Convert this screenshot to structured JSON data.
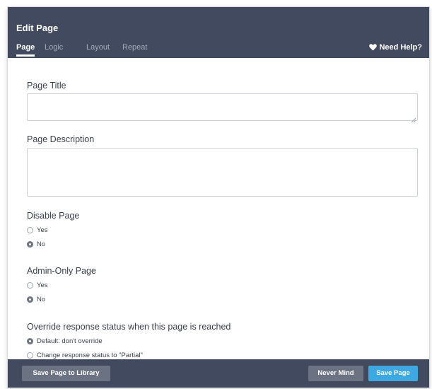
{
  "header": {
    "title": "Edit Page",
    "tabs": [
      {
        "label": "Page",
        "active": true
      },
      {
        "label": "Logic",
        "active": false
      },
      {
        "label": "Layout",
        "active": false
      },
      {
        "label": "Repeat",
        "active": false
      }
    ],
    "help_label": "Need Help?",
    "help_icon": "heart-icon"
  },
  "form": {
    "page_title": {
      "label": "Page Title",
      "value": ""
    },
    "page_description": {
      "label": "Page Description",
      "value": ""
    },
    "disable_page": {
      "label": "Disable Page",
      "options": [
        {
          "label": "Yes",
          "checked": false
        },
        {
          "label": "No",
          "checked": true
        }
      ]
    },
    "admin_only": {
      "label": "Admin-Only Page",
      "options": [
        {
          "label": "Yes",
          "checked": false
        },
        {
          "label": "No",
          "checked": true
        }
      ]
    },
    "override_status": {
      "label": "Override response status when this page is reached",
      "options": [
        {
          "label": "Default: don't override",
          "checked": true
        },
        {
          "label": "Change response status to \"Partial\"",
          "checked": false
        }
      ]
    }
  },
  "footer": {
    "save_library_label": "Save Page to Library",
    "never_mind_label": "Never Mind",
    "save_page_label": "Save Page"
  },
  "colors": {
    "header_bg": "#414a5e",
    "primary_button": "#3ea8e2",
    "secondary_button": "#6b7282"
  }
}
